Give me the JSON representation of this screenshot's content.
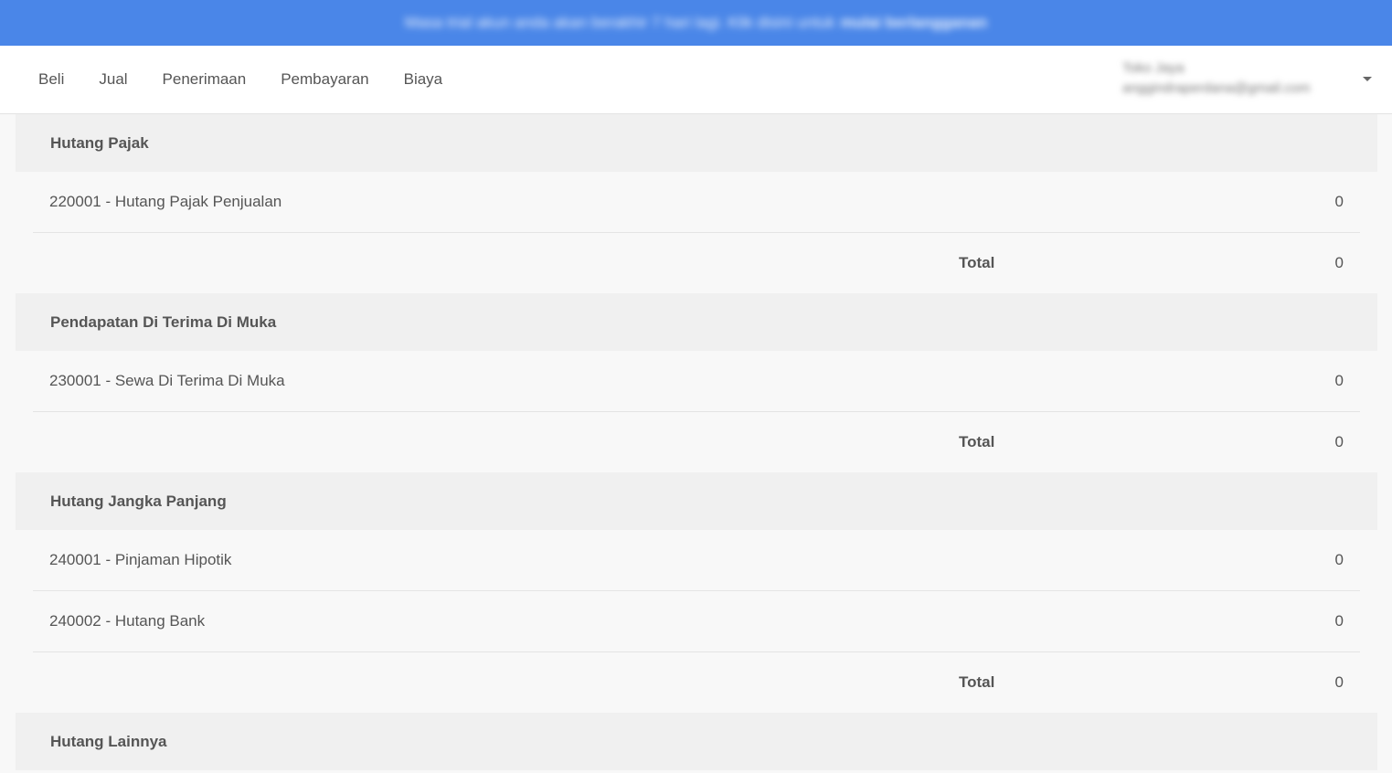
{
  "banner": {
    "text": "Masa trial akun anda akan berakhir 7 hari lagi. Klik disini untuk",
    "link": "mulai berlangganan"
  },
  "nav": {
    "items": [
      "Beli",
      "Jual",
      "Penerimaan",
      "Pembayaran",
      "Biaya"
    ]
  },
  "user": {
    "name": "Toko Jaya",
    "email": "anggindraperdana@gmail.com"
  },
  "groups": [
    {
      "title": "Hutang Pajak",
      "rows": [
        {
          "account": "220001 - Hutang Pajak Penjualan",
          "value": "0"
        }
      ],
      "total_label": "Total",
      "total_value": "0"
    },
    {
      "title": "Pendapatan Di Terima Di Muka",
      "rows": [
        {
          "account": "230001 - Sewa Di Terima Di Muka",
          "value": "0"
        }
      ],
      "total_label": "Total",
      "total_value": "0"
    },
    {
      "title": "Hutang Jangka Panjang",
      "rows": [
        {
          "account": "240001 - Pinjaman Hipotik",
          "value": "0"
        },
        {
          "account": "240002 - Hutang Bank",
          "value": "0"
        }
      ],
      "total_label": "Total",
      "total_value": "0"
    },
    {
      "title": "Hutang Lainnya",
      "rows": [],
      "total_label": "",
      "total_value": ""
    }
  ]
}
